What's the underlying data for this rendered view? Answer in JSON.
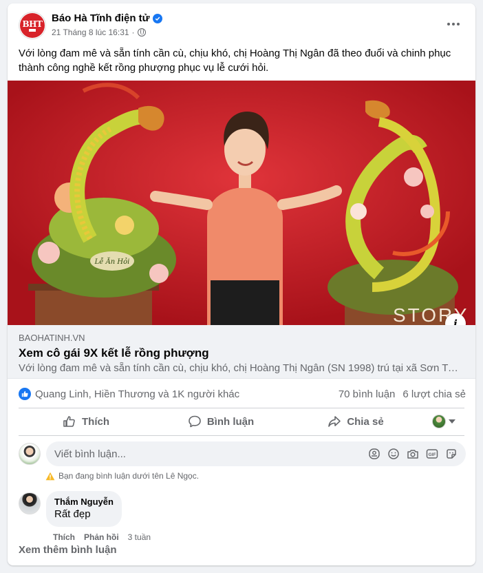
{
  "post": {
    "page_name": "Báo Hà Tĩnh điện tử",
    "logo_text": "BHT",
    "timestamp": "21 Tháng 8 lúc 16:31",
    "separator": "·",
    "text": "Với lòng đam mê và sẵn tính cần cù, chịu khó, chị Hoàng Thị Ngân đã theo đuổi và chinh phục thành công nghề kết rồng phượng phục vụ lễ cưới hỏi."
  },
  "media": {
    "tray_text": "Lễ Ăn Hỏi",
    "watermark": "STORY",
    "info_label": "i"
  },
  "link_preview": {
    "domain": "BAOHATINH.VN",
    "title": "Xem cô gái 9X kết lễ rồng phượng",
    "description": "Với lòng đam mê và sẵn tính cần cù, chịu khó, chị Hoàng Thị Ngân (SN 1998) trú tại xã Sơn Trung, huyện Hương Sơn"
  },
  "stats": {
    "reactions_text": "Quang Linh, Hiền Thương và 1K người khác",
    "comments_count": "70 bình luận",
    "shares_count": "6 lượt chia sẻ"
  },
  "actions": {
    "like": "Thích",
    "comment": "Bình luận",
    "share": "Chia sẻ"
  },
  "composer": {
    "placeholder": "Viết bình luận...",
    "gif_label": "GIF",
    "warning": "Bạn đang bình luận dưới tên Lê Ngọc."
  },
  "comments": [
    {
      "author": "Thắm Nguyễn",
      "text": "Rất đẹp",
      "like": "Thích",
      "reply": "Phản hồi",
      "time": "3 tuần"
    }
  ],
  "more_comments": "Xem thêm bình luận",
  "colors": {
    "brand_blue": "#1877f2",
    "logo_red": "#d8232a",
    "warning_yellow": "#f7b928"
  }
}
